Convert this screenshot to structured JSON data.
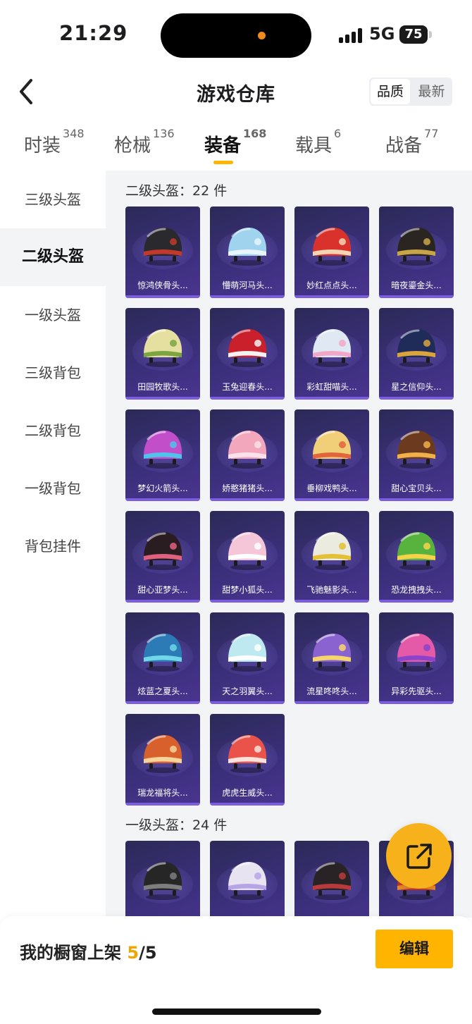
{
  "status_bar": {
    "time": "21:29",
    "network": "5G",
    "battery": "75"
  },
  "nav": {
    "title": "游戏仓库",
    "sort_quality": "品质",
    "sort_latest": "最新"
  },
  "tabs": [
    {
      "label": "时装",
      "count": "348"
    },
    {
      "label": "枪械",
      "count": "136"
    },
    {
      "label": "装备",
      "count": "168"
    },
    {
      "label": "载具",
      "count": "6"
    },
    {
      "label": "战备",
      "count": "77"
    }
  ],
  "sidebar": [
    "三级头盔",
    "二级头盔",
    "一级头盔",
    "三级背包",
    "二级背包",
    "一级背包",
    "背包挂件"
  ],
  "section_level2": {
    "title": "二级头盔：22 件",
    "items": [
      {
        "name": "惊鸿侠骨头...",
        "color": "#2a2a2e",
        "accent": "#c0392b"
      },
      {
        "name": "懵萌河马头...",
        "color": "#9fd3ee",
        "accent": "#e8f5fb"
      },
      {
        "name": "妙红点点头...",
        "color": "#d9322c",
        "accent": "#f3d4b3"
      },
      {
        "name": "暗夜鎏金头...",
        "color": "#2b2521",
        "accent": "#c9a54a"
      },
      {
        "name": "田园牧歌头...",
        "color": "#e6e0a0",
        "accent": "#7aa541"
      },
      {
        "name": "玉兔迎春头...",
        "color": "#c9202b",
        "accent": "#f2f2f2"
      },
      {
        "name": "彩虹甜喵头...",
        "color": "#dfe8f3",
        "accent": "#f3a7c8"
      },
      {
        "name": "星之信仰头...",
        "color": "#1f2b58",
        "accent": "#d9a43c"
      },
      {
        "name": "梦幻火箭头...",
        "color": "#c24fc9",
        "accent": "#4fc3ea"
      },
      {
        "name": "娇憨猪猪头...",
        "color": "#f2a7bd",
        "accent": "#fbe1e9"
      },
      {
        "name": "垂柳戏鸭头...",
        "color": "#f1cf78",
        "accent": "#e2663c"
      },
      {
        "name": "甜心宝贝头...",
        "color": "#6b3a1f",
        "accent": "#f0b04a"
      },
      {
        "name": "甜心亚梦头...",
        "color": "#2a1d22",
        "accent": "#e0607f"
      },
      {
        "name": "甜梦小狐头...",
        "color": "#f5c6d8",
        "accent": "#ffffff"
      },
      {
        "name": "飞驰魅影头...",
        "color": "#ecebdf",
        "accent": "#e3c034"
      },
      {
        "name": "恐龙拽拽头...",
        "color": "#58b23e",
        "accent": "#f4d34a"
      },
      {
        "name": "炫蓝之夏头...",
        "color": "#2c7bb6",
        "accent": "#6fd7e8"
      },
      {
        "name": "天之羽翼头...",
        "color": "#bfe9f1",
        "accent": "#ffffff"
      },
      {
        "name": "流星咚咚头...",
        "color": "#8b63d1",
        "accent": "#f6d66a"
      },
      {
        "name": "异彩先驱头...",
        "color": "#e45aa8",
        "accent": "#8a43c9"
      },
      {
        "name": "瑞龙福将头...",
        "color": "#d8602c",
        "accent": "#f5d39a"
      },
      {
        "name": "虎虎生威头...",
        "color": "#e9534a",
        "accent": "#fbe3dc"
      }
    ]
  },
  "section_level1": {
    "title": "一级头盔：24 件",
    "items": [
      {
        "name": "",
        "color": "#262626",
        "accent": "#7e7e7e"
      },
      {
        "name": "",
        "color": "#e7e3f0",
        "accent": "#b7a4e6"
      },
      {
        "name": "",
        "color": "#2a2326",
        "accent": "#b83a3a"
      },
      {
        "name": "",
        "color": "#d0352b",
        "accent": "#f08c2a"
      }
    ]
  },
  "bottom_bar": {
    "label": "我的橱窗上架",
    "current": "5",
    "total": "/5",
    "edit": "编辑"
  },
  "colors": {
    "accent": "#ffb400",
    "card_bg": "#3a2f7a"
  }
}
